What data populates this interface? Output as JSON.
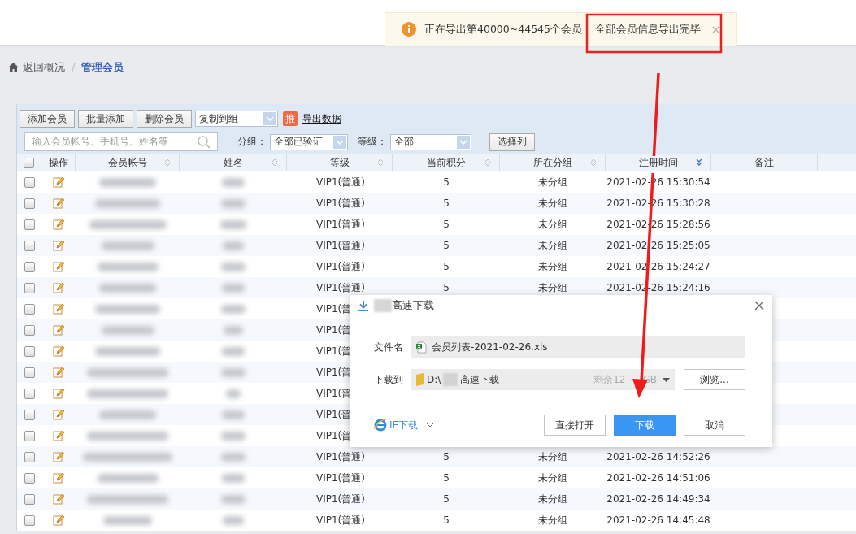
{
  "toast": {
    "message": "正在导出第40000~44545个会员",
    "overlay_message": "全部会员信息导出完毕"
  },
  "breadcrumb": {
    "back": "返回概况",
    "separator": "/",
    "current": "管理会员"
  },
  "toolbar": {
    "buttons": [
      "添加会员",
      "批量添加",
      "删除会员"
    ],
    "copy_select": "复制到组",
    "badge": "推",
    "export_link": "导出数据"
  },
  "filters": {
    "search_placeholder": "输入会员帐号、手机号、姓名等",
    "group_label": "分组：",
    "group_value": "全部已验证",
    "level_label": "等级：",
    "level_value": "全部",
    "columns_button": "选择列"
  },
  "table": {
    "header_checked": false,
    "columns": [
      {
        "label": "操作",
        "sortable": false,
        "sorted": false
      },
      {
        "label": "会员帐号",
        "sortable": true,
        "sorted": false
      },
      {
        "label": "姓名",
        "sortable": true,
        "sorted": false
      },
      {
        "label": "等级",
        "sortable": true,
        "sorted": false
      },
      {
        "label": "当前积分",
        "sortable": true,
        "sorted": false
      },
      {
        "label": "所在分组",
        "sortable": true,
        "sorted": false
      },
      {
        "label": "注册时间",
        "sortable": true,
        "sorted": true
      },
      {
        "label": "备注",
        "sortable": false,
        "sorted": false
      }
    ],
    "rows": [
      {
        "checked": false,
        "level": "VIP1(普通)",
        "points": "5",
        "group": "未分组",
        "registered": "2021-02-26 15:30:54"
      },
      {
        "checked": false,
        "level": "VIP1(普通)",
        "points": "5",
        "group": "未分组",
        "registered": "2021-02-26 15:30:28"
      },
      {
        "checked": false,
        "level": "VIP1(普通)",
        "points": "5",
        "group": "未分组",
        "registered": "2021-02-26 15:28:56"
      },
      {
        "checked": false,
        "level": "VIP1(普通)",
        "points": "5",
        "group": "未分组",
        "registered": "2021-02-26 15:25:05"
      },
      {
        "checked": false,
        "level": "VIP1(普通)",
        "points": "5",
        "group": "未分组",
        "registered": "2021-02-26 15:24:27"
      },
      {
        "checked": false,
        "level": "VIP1(普通)",
        "points": "5",
        "group": "未分组",
        "registered": "2021-02-26 15:24:16"
      },
      {
        "checked": false,
        "level": "VIP1(普"
      },
      {
        "checked": false,
        "level": "VIP1(普"
      },
      {
        "checked": false,
        "level": "VIP1(普"
      },
      {
        "checked": false,
        "level": "VIP1(普"
      },
      {
        "checked": false,
        "level": "VIP1(普"
      },
      {
        "checked": false,
        "level": "VIP1(普"
      },
      {
        "checked": false,
        "level": "VIP1(普"
      },
      {
        "checked": false,
        "level": "VIP1(普通)",
        "points": "5",
        "group": "未分组",
        "registered": "2021-02-26 14:52:26"
      },
      {
        "checked": false,
        "level": "VIP1(普通)",
        "points": "5",
        "group": "未分组",
        "registered": "2021-02-26 14:51:06"
      },
      {
        "checked": false,
        "level": "VIP1(普通)",
        "points": "5",
        "group": "未分组",
        "registered": "2021-02-26 14:49:34"
      },
      {
        "checked": false,
        "level": "VIP1(普通)",
        "points": "5",
        "group": "未分组",
        "registered": "2021-02-26 14:45:48"
      }
    ]
  },
  "dialog": {
    "title": "高速下载",
    "filename_label": "文件名",
    "filename": "会员列表-2021-02-26.xls",
    "path_label": "下载到",
    "path_prefix": "D:\\",
    "path_suffix": "高速下载",
    "free_space": "剩余12",
    "free_space_unit": "GB",
    "browse": "浏览...",
    "ie_download": "IE下载",
    "buttons": [
      {
        "label": "直接打开",
        "primary": false
      },
      {
        "label": "下载",
        "primary": true
      },
      {
        "label": "取消",
        "primary": false
      }
    ]
  }
}
